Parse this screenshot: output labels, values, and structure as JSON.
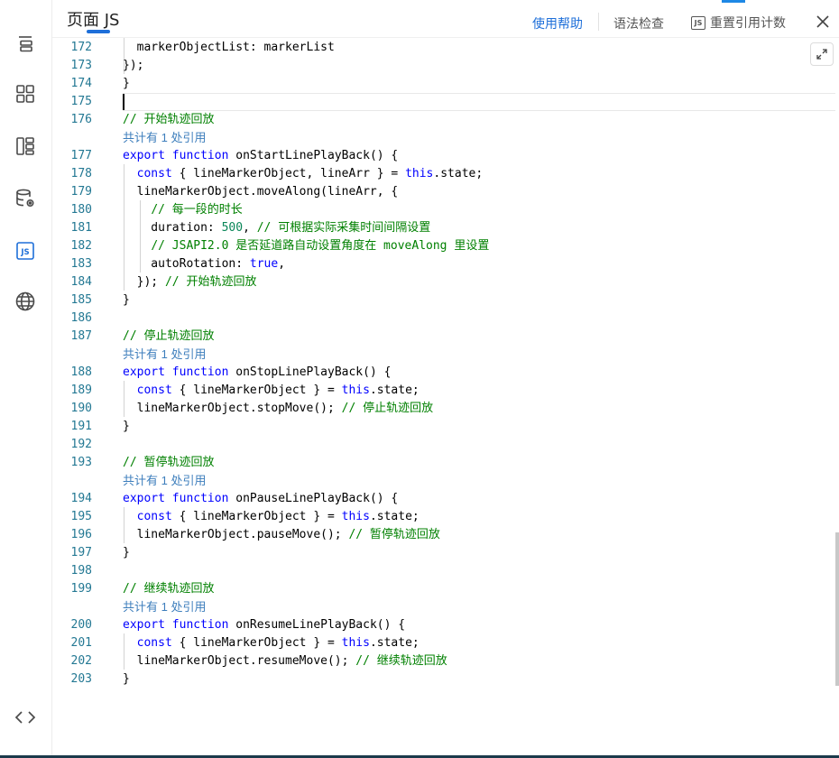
{
  "header": {
    "title": "页面 JS",
    "help": "使用帮助",
    "lint": "语法检查",
    "reset": "重置引用计数",
    "js_icon_text": "JS"
  },
  "sidebar": {
    "items": [
      {
        "icon": "outline-icon"
      },
      {
        "icon": "components-icon"
      },
      {
        "icon": "layout-icon"
      },
      {
        "icon": "datasource-icon"
      },
      {
        "icon": "js-icon",
        "label": "JS",
        "active": true
      },
      {
        "icon": "globe-icon"
      },
      {
        "icon": "code-icon"
      }
    ]
  },
  "colors": {
    "accent": "#1e6fd9",
    "line_number": "#237893",
    "keyword": "#0000ff",
    "comment": "#008000",
    "number": "#098658",
    "codelens": "#3d7ebc"
  },
  "editor": {
    "cursor_line": "175",
    "lines": [
      {
        "n": "172",
        "segs": [
          {
            "t": "  markerObjectList: markerList"
          }
        ]
      },
      {
        "n": "173",
        "segs": [
          {
            "t": "});"
          }
        ]
      },
      {
        "n": "174",
        "segs": [
          {
            "t": "}"
          }
        ]
      },
      {
        "n": "175",
        "segs": []
      },
      {
        "n": "176",
        "segs": [
          {
            "t": "// 开始轨迹回放",
            "c": "cm"
          }
        ]
      },
      {
        "lens": "共计有 1 处引用"
      },
      {
        "n": "177",
        "segs": [
          {
            "t": "export",
            "c": "kw"
          },
          {
            "t": " "
          },
          {
            "t": "function",
            "c": "kw"
          },
          {
            "t": " onStartLinePlayBack() {"
          }
        ]
      },
      {
        "n": "178",
        "segs": [
          {
            "t": "  "
          },
          {
            "t": "const",
            "c": "kw"
          },
          {
            "t": " { lineMarkerObject, lineArr } = "
          },
          {
            "t": "this",
            "c": "kw"
          },
          {
            "t": ".state;"
          }
        ]
      },
      {
        "n": "179",
        "segs": [
          {
            "t": "  lineMarkerObject.moveAlong(lineArr, {"
          }
        ]
      },
      {
        "n": "180",
        "segs": [
          {
            "t": "    "
          },
          {
            "t": "// 每一段的时长",
            "c": "cm"
          }
        ]
      },
      {
        "n": "181",
        "segs": [
          {
            "t": "    duration: "
          },
          {
            "t": "500",
            "c": "num"
          },
          {
            "t": ", "
          },
          {
            "t": "// 可根据实际采集时间间隔设置",
            "c": "cm"
          }
        ]
      },
      {
        "n": "182",
        "segs": [
          {
            "t": "    "
          },
          {
            "t": "// JSAPI2.0 是否延道路自动设置角度在 moveAlong 里设置",
            "c": "cm"
          }
        ]
      },
      {
        "n": "183",
        "segs": [
          {
            "t": "    autoRotation: "
          },
          {
            "t": "true",
            "c": "kw"
          },
          {
            "t": ","
          }
        ]
      },
      {
        "n": "184",
        "segs": [
          {
            "t": "  }); "
          },
          {
            "t": "// 开始轨迹回放",
            "c": "cm"
          }
        ]
      },
      {
        "n": "185",
        "segs": [
          {
            "t": "}"
          }
        ]
      },
      {
        "n": "186",
        "segs": []
      },
      {
        "n": "187",
        "segs": [
          {
            "t": "// 停止轨迹回放",
            "c": "cm"
          }
        ]
      },
      {
        "lens": "共计有 1 处引用"
      },
      {
        "n": "188",
        "segs": [
          {
            "t": "export",
            "c": "kw"
          },
          {
            "t": " "
          },
          {
            "t": "function",
            "c": "kw"
          },
          {
            "t": " onStopLinePlayBack() {"
          }
        ]
      },
      {
        "n": "189",
        "segs": [
          {
            "t": "  "
          },
          {
            "t": "const",
            "c": "kw"
          },
          {
            "t": " { lineMarkerObject } = "
          },
          {
            "t": "this",
            "c": "kw"
          },
          {
            "t": ".state;"
          }
        ]
      },
      {
        "n": "190",
        "segs": [
          {
            "t": "  lineMarkerObject.stopMove(); "
          },
          {
            "t": "// 停止轨迹回放",
            "c": "cm"
          }
        ]
      },
      {
        "n": "191",
        "segs": [
          {
            "t": "}"
          }
        ]
      },
      {
        "n": "192",
        "segs": []
      },
      {
        "n": "193",
        "segs": [
          {
            "t": "// 暂停轨迹回放",
            "c": "cm"
          }
        ]
      },
      {
        "lens": "共计有 1 处引用"
      },
      {
        "n": "194",
        "segs": [
          {
            "t": "export",
            "c": "kw"
          },
          {
            "t": " "
          },
          {
            "t": "function",
            "c": "kw"
          },
          {
            "t": " onPauseLinePlayBack() {"
          }
        ]
      },
      {
        "n": "195",
        "segs": [
          {
            "t": "  "
          },
          {
            "t": "const",
            "c": "kw"
          },
          {
            "t": " { lineMarkerObject } = "
          },
          {
            "t": "this",
            "c": "kw"
          },
          {
            "t": ".state;"
          }
        ]
      },
      {
        "n": "196",
        "segs": [
          {
            "t": "  lineMarkerObject.pauseMove(); "
          },
          {
            "t": "// 暂停轨迹回放",
            "c": "cm"
          }
        ]
      },
      {
        "n": "197",
        "segs": [
          {
            "t": "}"
          }
        ]
      },
      {
        "n": "198",
        "segs": []
      },
      {
        "n": "199",
        "segs": [
          {
            "t": "// 继续轨迹回放",
            "c": "cm"
          }
        ]
      },
      {
        "lens": "共计有 1 处引用"
      },
      {
        "n": "200",
        "segs": [
          {
            "t": "export",
            "c": "kw"
          },
          {
            "t": " "
          },
          {
            "t": "function",
            "c": "kw"
          },
          {
            "t": " onResumeLinePlayBack() {"
          }
        ]
      },
      {
        "n": "201",
        "segs": [
          {
            "t": "  "
          },
          {
            "t": "const",
            "c": "kw"
          },
          {
            "t": " { lineMarkerObject } = "
          },
          {
            "t": "this",
            "c": "kw"
          },
          {
            "t": ".state;"
          }
        ]
      },
      {
        "n": "202",
        "segs": [
          {
            "t": "  lineMarkerObject.resumeMove(); "
          },
          {
            "t": "// 继续轨迹回放",
            "c": "cm"
          }
        ]
      },
      {
        "n": "203",
        "segs": [
          {
            "t": "}"
          }
        ]
      }
    ]
  }
}
